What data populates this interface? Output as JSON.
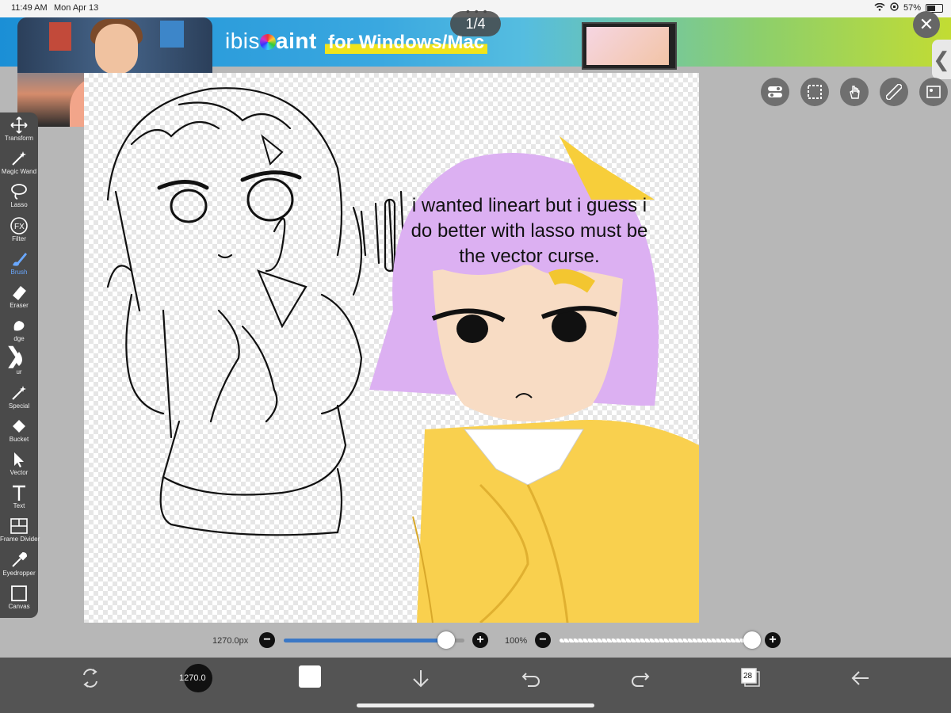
{
  "status": {
    "time": "11:49 AM",
    "date": "Mon Apr 13",
    "battery": "57%"
  },
  "banner": {
    "brand_prefix": "ibis",
    "brand_suffix": "aint",
    "tagline": "for Windows/Mac",
    "pager": "1/4",
    "close": "✕"
  },
  "side_tab": "❮",
  "canvas": {
    "caption": "i wanted lineart but i guess i do better with lasso must be the vector curse."
  },
  "tools": [
    {
      "name": "transform",
      "label": "Transform",
      "icon": "move-icon"
    },
    {
      "name": "magic-wand",
      "label": "Magic Wand",
      "icon": "magic-wand-icon"
    },
    {
      "name": "lasso",
      "label": "Lasso",
      "icon": "lasso-icon"
    },
    {
      "name": "filter",
      "label": "Filter",
      "icon": "fx-icon"
    },
    {
      "name": "brush",
      "label": "Brush",
      "icon": "brush-icon",
      "active": true
    },
    {
      "name": "eraser",
      "label": "Eraser",
      "icon": "eraser-icon"
    },
    {
      "name": "smudge",
      "label": "dge",
      "icon": "smudge-icon"
    },
    {
      "name": "blur",
      "label": "ur",
      "icon": "blur-icon"
    },
    {
      "name": "special",
      "label": "Special",
      "icon": "special-icon"
    },
    {
      "name": "bucket",
      "label": "Bucket",
      "icon": "bucket-icon"
    },
    {
      "name": "vector",
      "label": "Vector",
      "icon": "vector-icon"
    },
    {
      "name": "text",
      "label": "Text",
      "icon": "text-icon"
    },
    {
      "name": "frame-divider",
      "label": "Frame Divider",
      "icon": "frame-divider-icon"
    },
    {
      "name": "eyedropper",
      "label": "Eyedropper",
      "icon": "eyedropper-icon"
    },
    {
      "name": "canvas",
      "label": "Canvas",
      "icon": "canvas-icon"
    }
  ],
  "sliders": {
    "size_label": "1270.0px",
    "size_fraction": 0.9,
    "opacity_label": "100%",
    "opacity_fraction": 1.0,
    "minus": "−",
    "plus": "+"
  },
  "bottom": {
    "brush_size_text": "1270.0",
    "layers_count": "28"
  },
  "colors": {
    "accent_blue": "#3b78c6",
    "toolbar": "#4a4a4a",
    "bottom_bar": "#545454",
    "active_label": "#6aa8ff"
  }
}
